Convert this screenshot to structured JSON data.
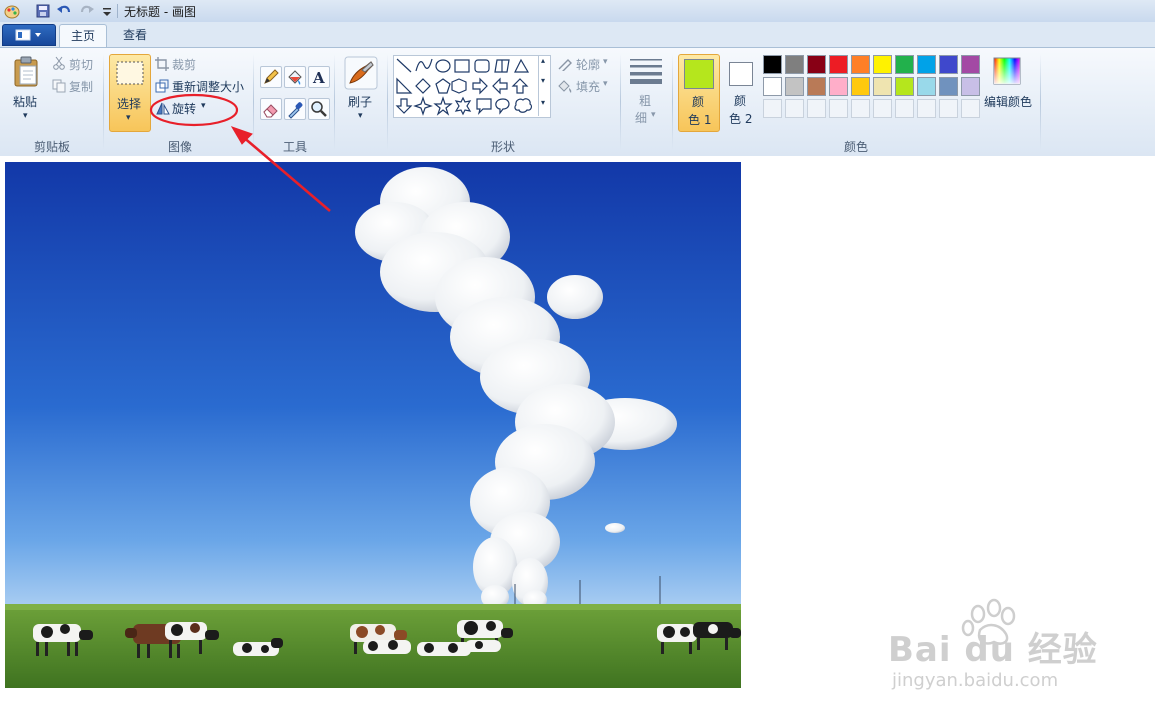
{
  "window": {
    "title": "无标题 - 画图"
  },
  "tabs": [
    {
      "label": "主页",
      "active": true
    },
    {
      "label": "查看",
      "active": false
    }
  ],
  "ribbon": {
    "clipboard": {
      "group_label": "剪贴板",
      "paste_label": "粘贴",
      "cut_label": "剪切",
      "copy_label": "复制"
    },
    "image": {
      "group_label": "图像",
      "select_label": "选择",
      "crop_label": "裁剪",
      "resize_label": "重新调整大小",
      "rotate_label": "旋转"
    },
    "tools": {
      "group_label": "工具",
      "icons": [
        "pencil-icon",
        "fill-icon",
        "text-icon",
        "eraser-icon",
        "color-picker-icon",
        "magnifier-icon"
      ]
    },
    "brushes": {
      "label": "刷子"
    },
    "shapes": {
      "group_label": "形状",
      "outline_label": "轮廓",
      "fill_label": "填充"
    },
    "size": {
      "label_line1": "粗",
      "label_line2": "细"
    },
    "colors": {
      "group_label": "颜色",
      "color1_line1": "颜",
      "color1_line2": "色 1",
      "color2_line1": "颜",
      "color2_line2": "色 2",
      "edit_label": "编辑颜色",
      "color1_value": "#b5e61d",
      "color2_value": "#ffffff",
      "palette_row1": [
        "#000000",
        "#7f7f7f",
        "#880015",
        "#ed1c24",
        "#ff7f27",
        "#fff200",
        "#22b14c",
        "#00a2e8",
        "#3f48cc",
        "#a349a4"
      ],
      "palette_row2": [
        "#ffffff",
        "#c3c3c3",
        "#b97a57",
        "#ffaec9",
        "#ffc90e",
        "#efe4b0",
        "#b5e61d",
        "#99d9ea",
        "#7092be",
        "#c8bfe7"
      ]
    }
  },
  "watermark": {
    "brand": "Bai du 经验",
    "url": "jingyan.baidu.com"
  },
  "annotation": {
    "color": "#e8202a",
    "target": "旋转"
  }
}
